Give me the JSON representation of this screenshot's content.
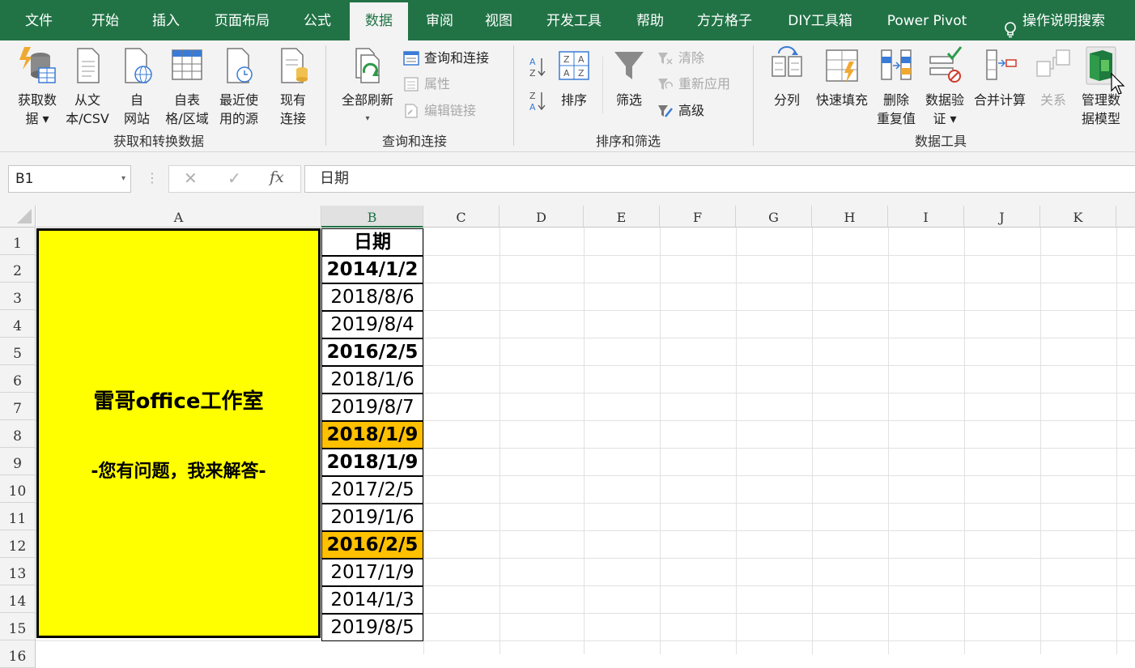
{
  "tabs": [
    "文件",
    "开始",
    "插入",
    "页面布局",
    "公式",
    "数据",
    "审阅",
    "视图",
    "开发工具",
    "帮助",
    "方方格子",
    "DIY工具箱",
    "Power Pivot",
    "操作说明搜索"
  ],
  "active_tab": "数据",
  "ribbon": {
    "groups": {
      "get_transform": "获取和转换数据",
      "queries": "查询和连接",
      "sort_filter": "排序和筛选",
      "data_tools": "数据工具"
    },
    "buttons": {
      "get_data": [
        "获取数",
        "据 ▾"
      ],
      "from_text": [
        "从文",
        "本/CSV"
      ],
      "from_web": [
        "自",
        "网站"
      ],
      "from_table": [
        "自表",
        "格/区域"
      ],
      "recent_sources": [
        "最近使",
        "用的源"
      ],
      "existing_conn": [
        "现有",
        "连接"
      ],
      "refresh_all": [
        "全部刷新",
        "▾"
      ],
      "queries_conn": "查询和连接",
      "properties": "属性",
      "edit_links": "编辑链接",
      "sort": "排序",
      "filter": "筛选",
      "clear": "清除",
      "reapply": "重新应用",
      "advanced": "高级",
      "text_to_cols": "分列",
      "flash_fill": "快速填充",
      "remove_dup": [
        "删除",
        "重复值"
      ],
      "validation": [
        "数据验",
        "证 ▾"
      ],
      "consolidate": "合并计算",
      "relationships": "关系",
      "data_model": [
        "管理数",
        "据模型"
      ]
    }
  },
  "formula_bar": {
    "name_box": "B1",
    "formula": "日期",
    "cancel": "✕",
    "enter": "✓",
    "fx": "fx"
  },
  "columns": [
    "A",
    "B",
    "C",
    "D",
    "E",
    "F",
    "G",
    "H",
    "I",
    "J",
    "K"
  ],
  "rows": [
    "1",
    "2",
    "3",
    "4",
    "5",
    "6",
    "7",
    "8",
    "9",
    "10",
    "11",
    "12",
    "13",
    "14",
    "15",
    "16"
  ],
  "merged_cell": {
    "line1": "雷哥office工作室",
    "line2": "-您有问题，我来解答-",
    "fill": "#ffff00"
  },
  "column_b": [
    {
      "value": "日期",
      "bold": true,
      "highlight": false
    },
    {
      "value": "2014/1/2",
      "bold": true,
      "highlight": false
    },
    {
      "value": "2018/8/6",
      "bold": false,
      "highlight": false
    },
    {
      "value": "2019/8/4",
      "bold": false,
      "highlight": false
    },
    {
      "value": "2016/2/5",
      "bold": true,
      "highlight": false
    },
    {
      "value": "2018/1/6",
      "bold": false,
      "highlight": false
    },
    {
      "value": "2019/8/7",
      "bold": false,
      "highlight": false
    },
    {
      "value": "2018/1/9",
      "bold": true,
      "highlight": true
    },
    {
      "value": "2018/1/9",
      "bold": true,
      "highlight": false
    },
    {
      "value": "2017/2/5",
      "bold": false,
      "highlight": false
    },
    {
      "value": "2019/1/6",
      "bold": false,
      "highlight": false
    },
    {
      "value": "2016/2/5",
      "bold": true,
      "highlight": true
    },
    {
      "value": "2017/1/9",
      "bold": false,
      "highlight": false
    },
    {
      "value": "2014/1/3",
      "bold": false,
      "highlight": false
    },
    {
      "value": "2019/8/5",
      "bold": false,
      "highlight": false
    }
  ],
  "colors": {
    "excel_green": "#217346",
    "highlight_orange": "#ffc000",
    "merged_yellow": "#ffff00"
  }
}
